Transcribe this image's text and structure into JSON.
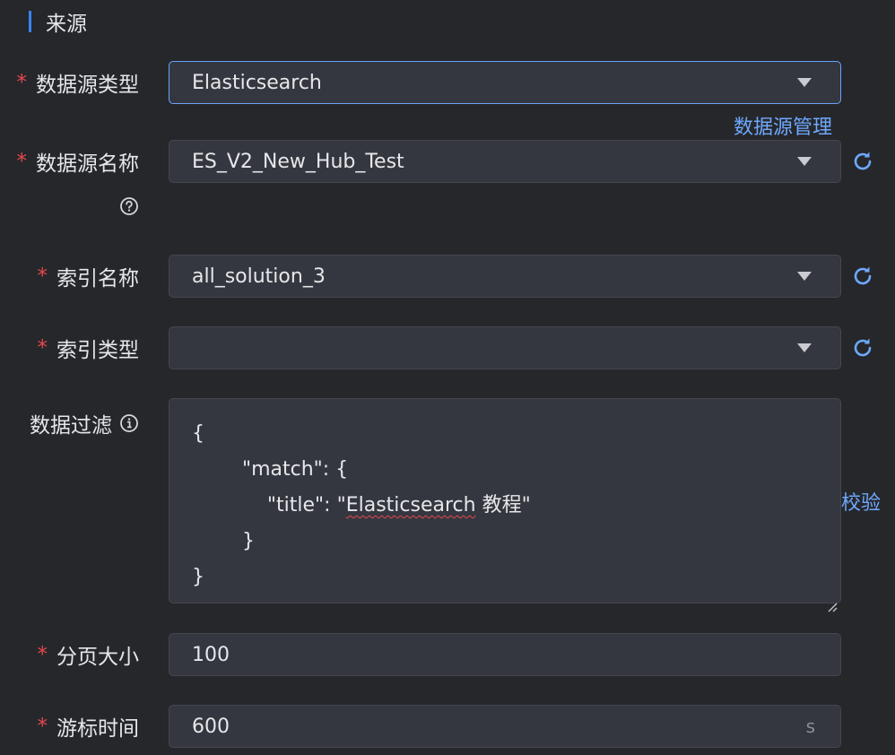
{
  "section": {
    "title": "来源"
  },
  "form": {
    "datasource_type": {
      "label": "数据源类型",
      "required": "*",
      "value": "Elasticsearch"
    },
    "datasource_manage_link": "数据源管理",
    "datasource_name": {
      "label": "数据源名称",
      "required": "*",
      "value": "ES_V2_New_Hub_Test"
    },
    "index_name": {
      "label": "索引名称",
      "required": "*",
      "value": "all_solution_3"
    },
    "index_type": {
      "label": "索引类型",
      "required": "*",
      "value": ""
    },
    "data_filter": {
      "label": "数据过滤",
      "lines": [
        "{",
        "        \"match\": {",
        "            \"title\": \"",
        "        }",
        "}"
      ],
      "line3_squiggle": "Elasticsearch",
      "line3_tail": " 教程\""
    },
    "validate_link": "校验",
    "page_size": {
      "label": "分页大小",
      "required": "*",
      "value": "100"
    },
    "cursor_time": {
      "label": "游标时间",
      "required": "*",
      "value": "600",
      "suffix": "s"
    }
  },
  "icons": {
    "help": "question-circle-icon",
    "info": "info-circle-icon",
    "refresh": "refresh-icon",
    "dropdown": "caret-down-icon"
  },
  "colors": {
    "background": "#26272b",
    "field_bg": "#353740",
    "accent": "#6ea8fe",
    "required": "#e5484d",
    "section_bar": "#3b82f6"
  }
}
